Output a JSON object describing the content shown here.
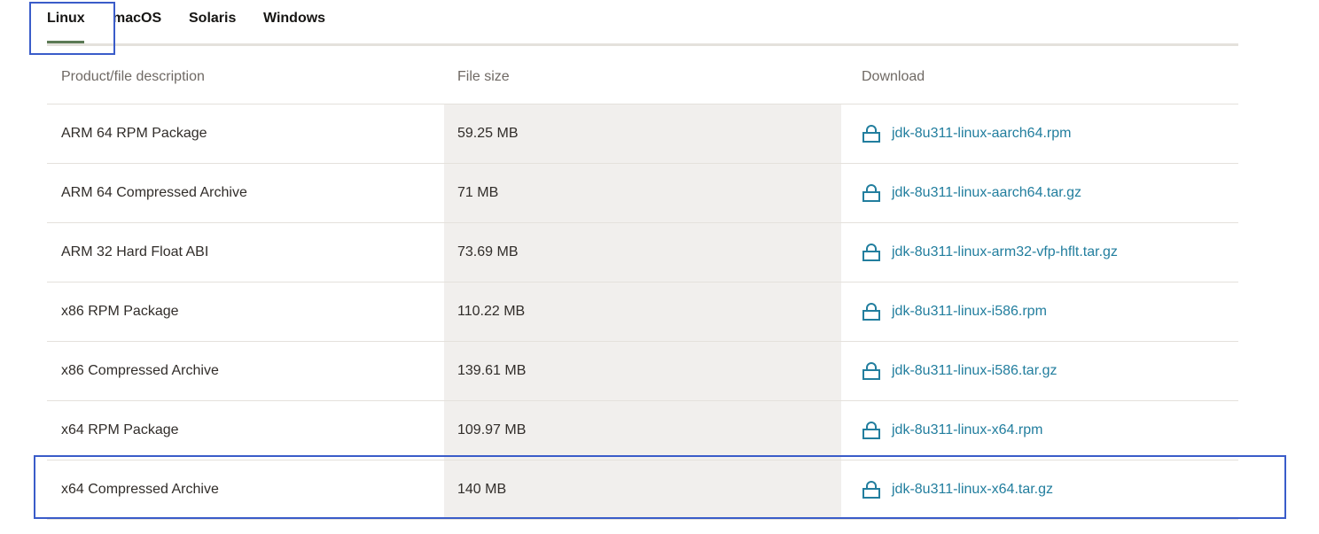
{
  "tabs": [
    {
      "label": "Linux",
      "active": true
    },
    {
      "label": "macOS",
      "active": false
    },
    {
      "label": "Solaris",
      "active": false
    },
    {
      "label": "Windows",
      "active": false
    }
  ],
  "table": {
    "headers": [
      "Product/file description",
      "File size",
      "Download"
    ],
    "rows": [
      {
        "description": "ARM 64 RPM Package",
        "size": "59.25 MB",
        "file": "jdk-8u311-linux-aarch64.rpm"
      },
      {
        "description": "ARM 64 Compressed Archive",
        "size": "71 MB",
        "file": "jdk-8u311-linux-aarch64.tar.gz"
      },
      {
        "description": "ARM 32 Hard Float ABI",
        "size": "73.69 MB",
        "file": "jdk-8u311-linux-arm32-vfp-hflt.tar.gz"
      },
      {
        "description": "x86 RPM Package",
        "size": "110.22 MB",
        "file": "jdk-8u311-linux-i586.rpm"
      },
      {
        "description": "x86 Compressed Archive",
        "size": "139.61 MB",
        "file": "jdk-8u311-linux-i586.tar.gz"
      },
      {
        "description": "x64 RPM Package",
        "size": "109.97 MB",
        "file": "jdk-8u311-linux-x64.rpm"
      },
      {
        "description": "x64 Compressed Archive",
        "size": "140 MB",
        "file": "jdk-8u311-linux-x64.tar.gz"
      }
    ]
  },
  "icons": {
    "download": "lock-icon"
  },
  "colors": {
    "link": "#227e9e",
    "active_tab_underline": "#5b7a55",
    "highlight_box": "#3a5cc9",
    "shaded_column": "#f1efed"
  }
}
